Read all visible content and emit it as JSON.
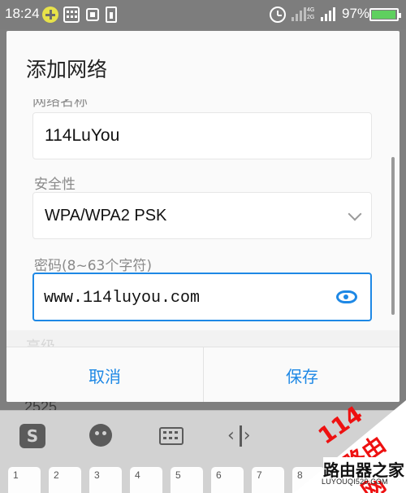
{
  "status_bar": {
    "time": "18:24",
    "network_top": "4G",
    "network_bottom": "2G",
    "battery_percent": "97%",
    "battery_level": 0.97,
    "icons": [
      "add-icon",
      "keyboard-icon",
      "scan-icon",
      "battery-saver-icon",
      "alarm-icon",
      "signal-icon",
      "signal-icon",
      "battery-icon"
    ]
  },
  "background": {
    "partial_text": "2525"
  },
  "dialog": {
    "title": "添加网络",
    "clipped_label": "网络名称",
    "ssid_value": "114LuYou",
    "security_label": "安全性",
    "security_value": "WPA/WPA2 PSK",
    "password_label": "密码(8~63个字符)",
    "password_value": "www.114luyou.com",
    "ghost_row_text": "高级",
    "cancel_label": "取消",
    "save_label": "保存",
    "accent_color": "#1e88e5"
  },
  "keyboard": {
    "logo_text": "S",
    "number_keys": [
      "1",
      "2",
      "3",
      "4",
      "5",
      "6",
      "7",
      "8"
    ]
  },
  "watermark": {
    "number": "114",
    "chinese": "路由网",
    "brand": "路由器之家",
    "url": "LUYOUQI520.COM"
  }
}
